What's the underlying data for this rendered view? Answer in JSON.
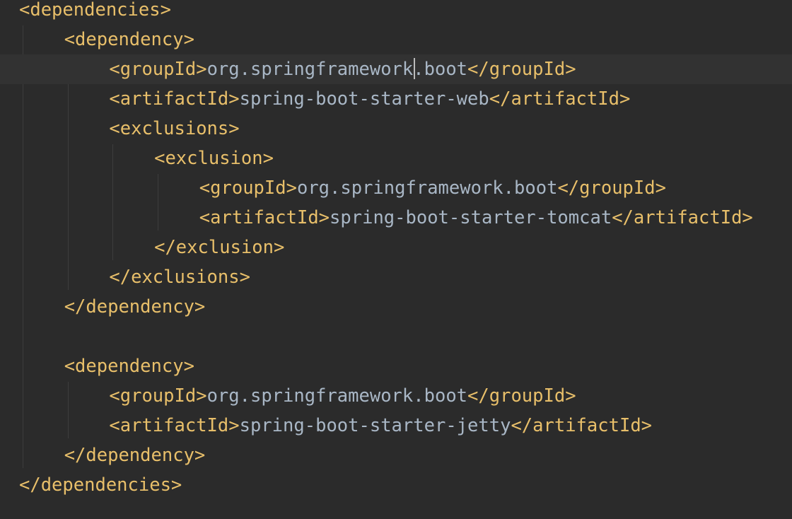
{
  "editor": {
    "language": "XML",
    "theme_colors": {
      "background": "#2b2b2b",
      "current_line": "#323232",
      "tag": "#e8bf6a",
      "text": "#a9b7c6",
      "indent_guide": "#3d3d3d"
    },
    "lines": [
      {
        "indent": 0,
        "open": "<dependencies>",
        "text": "",
        "close": ""
      },
      {
        "indent": 1,
        "open": "<dependency>",
        "text": "",
        "close": ""
      },
      {
        "indent": 2,
        "open": "<groupId>",
        "text": "org.springframework.boot",
        "close": "</groupId>",
        "current": true
      },
      {
        "indent": 2,
        "open": "<artifactId>",
        "text": "spring-boot-starter-web",
        "close": "</artifactId>"
      },
      {
        "indent": 2,
        "open": "<exclusions>",
        "text": "",
        "close": ""
      },
      {
        "indent": 3,
        "open": "<exclusion>",
        "text": "",
        "close": ""
      },
      {
        "indent": 4,
        "open": "<groupId>",
        "text": "org.springframework.boot",
        "close": "</groupId>"
      },
      {
        "indent": 4,
        "open": "<artifactId>",
        "text": "spring-boot-starter-tomcat",
        "close": "</artifactId>"
      },
      {
        "indent": 3,
        "open": "</exclusion>",
        "text": "",
        "close": ""
      },
      {
        "indent": 2,
        "open": "</exclusions>",
        "text": "",
        "close": ""
      },
      {
        "indent": 1,
        "open": "</dependency>",
        "text": "",
        "close": ""
      },
      {
        "indent": 0,
        "open": "",
        "text": "",
        "close": ""
      },
      {
        "indent": 1,
        "open": "<dependency>",
        "text": "",
        "close": ""
      },
      {
        "indent": 2,
        "open": "<groupId>",
        "text": "org.springframework.boot",
        "close": "</groupId>"
      },
      {
        "indent": 2,
        "open": "<artifactId>",
        "text": "spring-boot-starter-jetty",
        "close": "</artifactId>"
      },
      {
        "indent": 1,
        "open": "</dependency>",
        "text": "",
        "close": ""
      },
      {
        "indent": 0,
        "open": "</dependencies>",
        "text": "",
        "close": ""
      }
    ]
  }
}
